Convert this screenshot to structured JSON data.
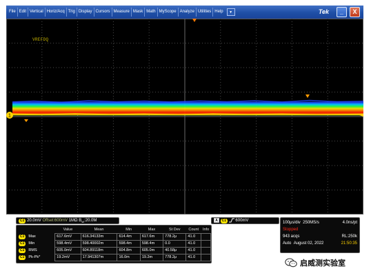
{
  "menu": {
    "items": [
      "File",
      "Edit",
      "Vertical",
      "Horiz/Acq",
      "Trig",
      "Display",
      "Cursors",
      "Measure",
      "Mask",
      "Math",
      "MyScope",
      "Analyze",
      "Utilities",
      "Help"
    ],
    "help_dropdown": "▼",
    "brand": "Tek",
    "minimize": "_",
    "close": "X"
  },
  "display": {
    "reference_label": "VREFDQ",
    "trace_color": "#ffd400",
    "grid_color": "#5a5a5a",
    "channel_marker": "1"
  },
  "channel1": {
    "badge": "C1",
    "scale": "20.0mV",
    "offset": "Offset:600mV",
    "impedance": "1MΩ",
    "bandwidth": "B",
    "bandwidth_sub": "W",
    "bandwidth_value": ":20.0M"
  },
  "trigger": {
    "mode_letter": "A",
    "badge": "C1",
    "slope_icon": "rising-edge-icon",
    "level": "600mV"
  },
  "measurements": {
    "headers": [
      "",
      "Value",
      "Mean",
      "Min",
      "Max",
      "St Dev",
      "Count",
      "Info"
    ],
    "rows": [
      {
        "badge": "C1",
        "label": "Max",
        "value": "617.6mV",
        "mean": "616.34133m",
        "min": "614.4m",
        "max": "617.6m",
        "stdev": "778.2μ",
        "count": "41.0",
        "info": ""
      },
      {
        "badge": "C1",
        "label": "Min",
        "value": "598.4mV",
        "mean": "598.40002m",
        "min": "598.4m",
        "max": "598.4m",
        "stdev": "0.0",
        "count": "41.0",
        "info": ""
      },
      {
        "badge": "C1",
        "label": "RMS",
        "value": "605.0mV",
        "mean": "604.89118m",
        "min": "604.8m",
        "max": "605.0m",
        "stdev": "40.58μ",
        "count": "41.0",
        "info": ""
      },
      {
        "badge": "C1",
        "label": "Pk-Pk*",
        "value": "19.2mV",
        "mean": "17.941307m",
        "min": "16.0m",
        "max": "19.2m",
        "stdev": "778.2μ",
        "count": "41.0",
        "info": ""
      }
    ]
  },
  "acquisition": {
    "timebase": "100μs/div",
    "sample_rate": "250MS/s",
    "resolution": "4.0ns/pt",
    "status": "Stopped",
    "acqs": "943 acqs",
    "record_length": "RL:250k",
    "mode": "Auto",
    "date": "August 02, 2022",
    "time": "21:50:35"
  },
  "watermark": {
    "text": "启威测实验室",
    "icon": "wechat-icon"
  }
}
